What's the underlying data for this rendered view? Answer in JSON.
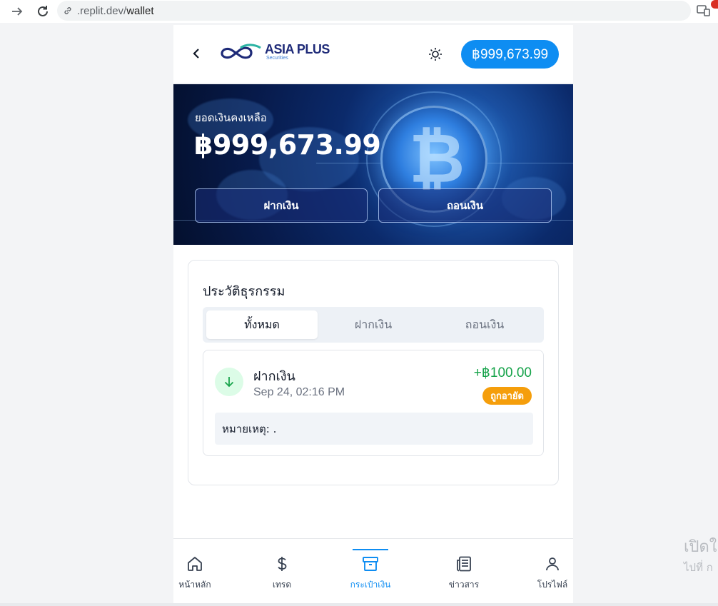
{
  "browser": {
    "url_prefix": ".replit.dev/",
    "url_path": "wallet"
  },
  "side_text": {
    "line1": "เปิดใ",
    "line2": "ไปที่ ก"
  },
  "header": {
    "logo_main": "ASIA PLUS",
    "logo_sub": "Securities",
    "balance": "฿999,673.99"
  },
  "hero": {
    "label": "ยอดเงินคงเหลือ",
    "amount": "฿999,673.99",
    "deposit_label": "ฝากเงิน",
    "withdraw_label": "ถอนเงิน"
  },
  "history": {
    "title": "ประวัติธุรกรรม",
    "tabs": [
      {
        "label": "ทั้งหมด",
        "active": true
      },
      {
        "label": "ฝากเงิน",
        "active": false
      },
      {
        "label": "ถอนเงิน",
        "active": false
      }
    ],
    "transactions": [
      {
        "type": "ฝากเงิน",
        "date": "Sep 24, 02:16 PM",
        "amount": "+฿100.00",
        "status": "ถูกอายัด",
        "note": "หมายเหตุ: ."
      }
    ]
  },
  "bottom_nav": [
    {
      "label": "หน้าหลัก",
      "icon": "home-icon",
      "active": false
    },
    {
      "label": "เทรด",
      "icon": "dollar-icon",
      "active": false
    },
    {
      "label": "กระเป๋าเงิน",
      "icon": "wallet-icon",
      "active": true
    },
    {
      "label": "ข่าวสาร",
      "icon": "news-icon",
      "active": false
    },
    {
      "label": "โปรไฟล์",
      "icon": "user-icon",
      "active": false
    }
  ],
  "colors": {
    "accent": "#0e8df2",
    "positive": "#16a34a",
    "badge": "#f59e0b"
  }
}
